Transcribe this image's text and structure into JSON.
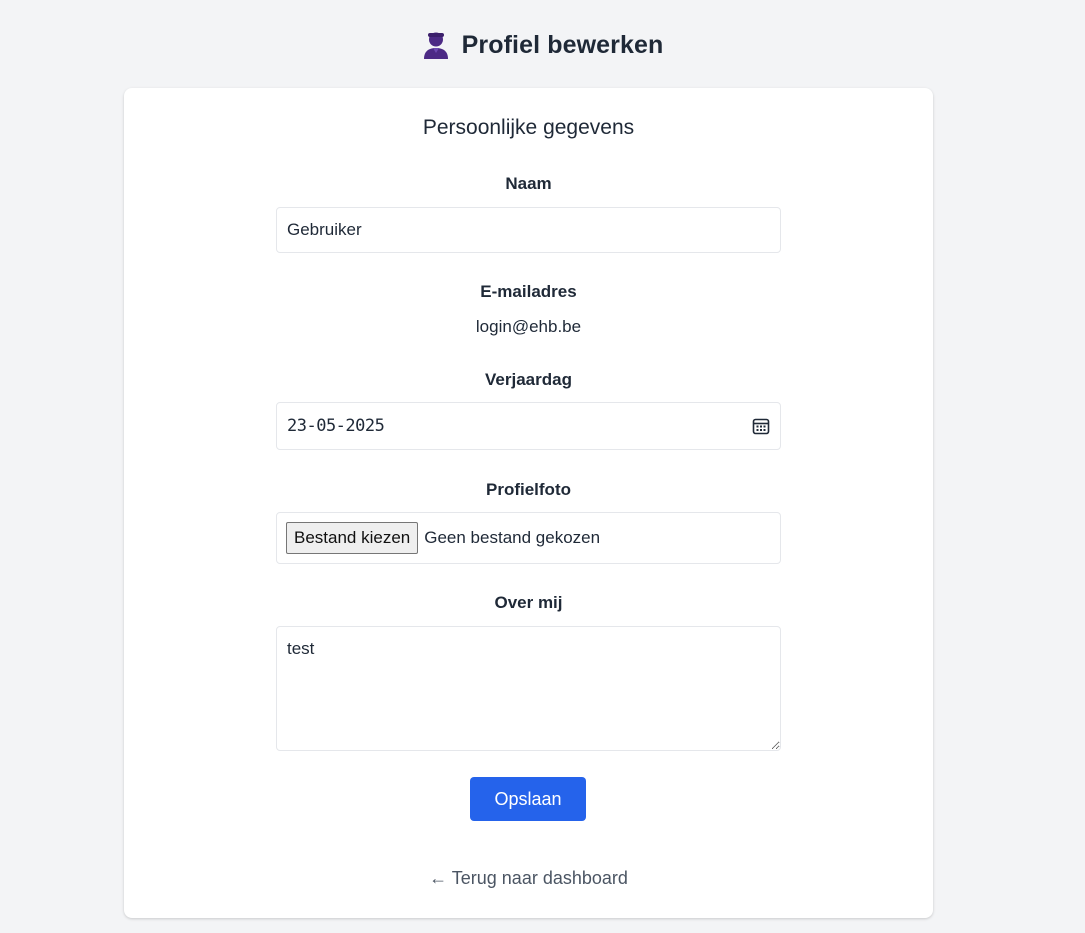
{
  "header": {
    "icon": "user-icon",
    "title": "Profiel bewerken"
  },
  "card": {
    "section_title": "Persoonlijke gegevens",
    "name": {
      "label": "Naam",
      "value": "Gebruiker"
    },
    "email": {
      "label": "E-mailadres",
      "value": "login@ehb.be"
    },
    "birthday": {
      "label": "Verjaardag",
      "value": "23-05-2025",
      "icon": "calendar-icon"
    },
    "photo": {
      "label": "Profielfoto",
      "button_label": "Bestand kiezen",
      "status": "Geen bestand gekozen"
    },
    "about": {
      "label": "Over mij",
      "value": "test"
    },
    "save_label": "Opslaan",
    "back_link": "← Terug naar dashboard"
  },
  "colors": {
    "background": "#f3f4f6",
    "card": "#ffffff",
    "primary": "#2563eb",
    "text": "#1f2937",
    "icon": "#4c2a85"
  }
}
